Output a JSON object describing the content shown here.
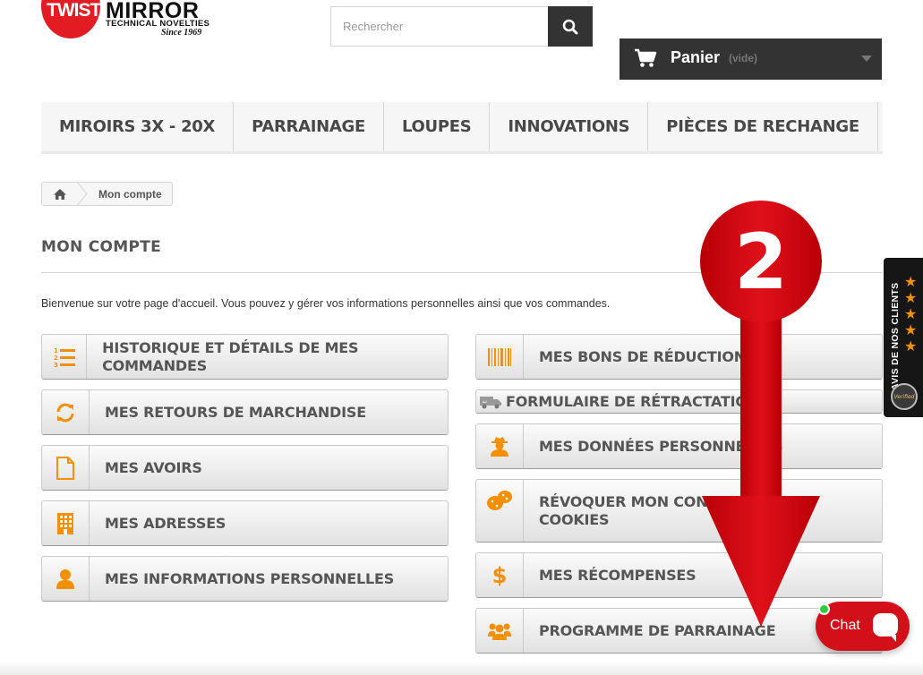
{
  "logo": {
    "brand_a": "TWIST",
    "brand_b": "MIRROR",
    "tagline": "TECHNICAL NOVELTIES",
    "since": "Since 1969"
  },
  "search": {
    "placeholder": "Rechercher"
  },
  "cart": {
    "label": "Panier",
    "status": "(vide)"
  },
  "menu": [
    "MIROIRS 3X - 20X",
    "PARRAINAGE",
    "LOUPES",
    "INNOVATIONS",
    "PIÈCES DE RECHANGE"
  ],
  "breadcrumb": {
    "current": "Mon compte"
  },
  "page": {
    "title": "MON COMPTE",
    "welcome": "Bienvenue sur votre page d'accueil. Vous pouvez y gérer vos informations personnelles ainsi que vos commandes."
  },
  "account_left": [
    {
      "label": "HISTORIQUE ET DÉTAILS DE MES COMMANDES",
      "icon": "ordered-list-icon"
    },
    {
      "label": "MES RETOURS DE MARCHANDISE",
      "icon": "refresh-icon"
    },
    {
      "label": "MES AVOIRS",
      "icon": "file-icon"
    },
    {
      "label": "MES ADRESSES",
      "icon": "building-icon"
    },
    {
      "label": "MES INFORMATIONS PERSONNELLES",
      "icon": "user-icon"
    }
  ],
  "account_right": [
    {
      "label": "MES BONS DE RÉDUCTION",
      "icon": "barcode-icon"
    },
    {
      "label": "FORMULAIRE DE RÉTRACTATION",
      "icon": "truck-icon"
    },
    {
      "label": "MES DONNÉES PERSONNELLES",
      "icon": "user-secret-icon"
    },
    {
      "label": "RÉVOQUER MON CONSENTEMENT AUX COOKIES",
      "label_line1": "RÉVOQUER MON CONSE",
      "label_line2": "COOKIES",
      "icon": "cookie-icon"
    },
    {
      "label": "MES RÉCOMPENSES",
      "icon": "dollar-icon"
    },
    {
      "label": "PROGRAMME DE PARRAINAGE",
      "icon": "users-icon"
    }
  ],
  "reviews_tab": {
    "label": "AVIS DE NOS CLIENTS",
    "stars": 5,
    "badge": "Verified"
  },
  "annotation": {
    "number": "2",
    "color": "#d9080f"
  },
  "chat": {
    "label": "Chat"
  },
  "colors": {
    "accent": "#f29000",
    "dark": "#333333",
    "chat": "#d3101a"
  }
}
